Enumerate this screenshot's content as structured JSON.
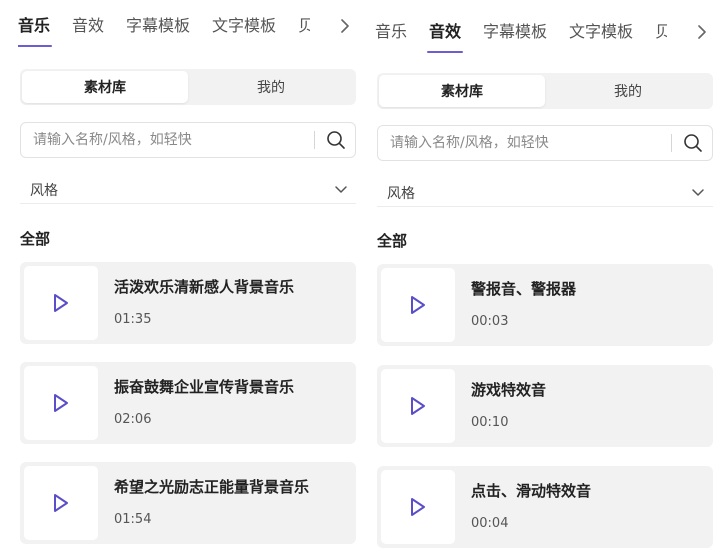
{
  "panels": [
    {
      "tabs": [
        "音乐",
        "音效",
        "字幕模板",
        "文字模板",
        "贝"
      ],
      "active_tab": 0,
      "segments": [
        "素材库",
        "我的"
      ],
      "search_placeholder": "请输入名称/风格，如轻快",
      "filter_label": "风格",
      "section_title": "全部",
      "items": [
        {
          "title": "活泼欢乐清新感人背景音乐",
          "duration": "01:35"
        },
        {
          "title": "振奋鼓舞企业宣传背景音乐",
          "duration": "02:06"
        },
        {
          "title": "希望之光励志正能量背景音乐",
          "duration": "01:54"
        }
      ]
    },
    {
      "tabs": [
        "音乐",
        "音效",
        "字幕模板",
        "文字模板",
        "贝"
      ],
      "active_tab": 1,
      "segments": [
        "素材库",
        "我的"
      ],
      "search_placeholder": "请输入名称/风格，如轻快",
      "filter_label": "风格",
      "section_title": "全部",
      "items": [
        {
          "title": "警报音、警报器",
          "duration": "00:03"
        },
        {
          "title": "游戏特效音",
          "duration": "00:10"
        },
        {
          "title": "点击、滑动特效音",
          "duration": "00:04"
        }
      ]
    }
  ],
  "icons": {
    "tabs_next": "chevron-right-icon",
    "search": "search-icon",
    "dropdown": "chevron-down-icon",
    "play": "play-icon"
  },
  "colors": {
    "accent": "#6c5dd3",
    "card_bg": "#f2f2f2",
    "play_icon": "#5b4fc9"
  }
}
